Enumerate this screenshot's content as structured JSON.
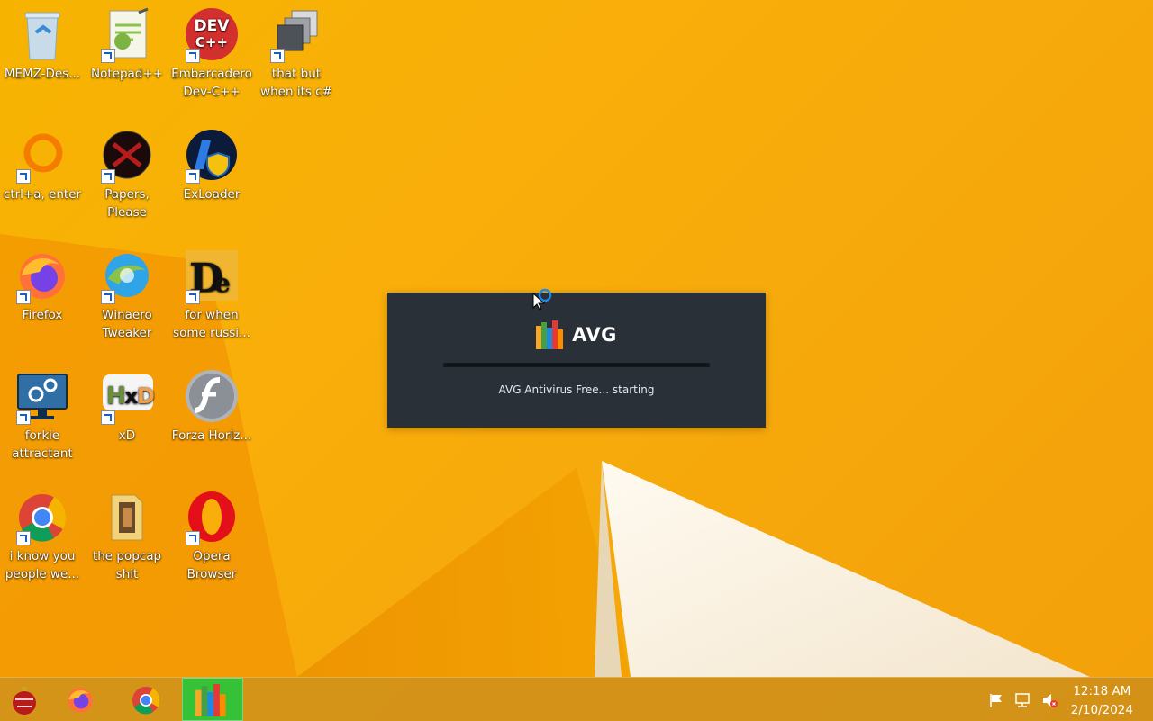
{
  "desktop": {
    "icons": [
      {
        "label": "MEMZ-Des...",
        "icon": "recycle-bin-icon"
      },
      {
        "label": "Notepad++",
        "icon": "notepadpp-icon"
      },
      {
        "label": "Embarcadero Dev-C++",
        "icon": "devcpp-icon"
      },
      {
        "label": "that but when its c#",
        "icon": "stack-icon"
      },
      {
        "label": "ctrl+a, enter",
        "icon": "orange-ring-icon"
      },
      {
        "label": "Papers, Please",
        "icon": "papers-please-icon"
      },
      {
        "label": "ExLoader",
        "icon": "exloader-icon"
      },
      {
        "label": "Firefox",
        "icon": "firefox-icon"
      },
      {
        "label": "Winaero Tweaker",
        "icon": "winaero-icon"
      },
      {
        "label": "for when some russi...",
        "icon": "de-icon"
      },
      {
        "label": "forkie attractant",
        "icon": "monitor-gear-icon"
      },
      {
        "label": "xD",
        "icon": "hxd-icon"
      },
      {
        "label": "Forza Horiz...",
        "icon": "flash-icon"
      },
      {
        "label": "i know you people we...",
        "icon": "chrome-icon"
      },
      {
        "label": "the popcap shit",
        "icon": "folder-icon"
      },
      {
        "label": "Opera Browser",
        "icon": "opera-icon"
      }
    ]
  },
  "splash": {
    "logo_text": "AVG",
    "status": "AVG Antivirus Free... starting",
    "progress": 0
  },
  "taskbar": {
    "buttons": [
      {
        "icon": "ornament-icon"
      },
      {
        "icon": "firefox-icon"
      },
      {
        "icon": "chrome-icon"
      },
      {
        "icon": "avg-icon",
        "active": true
      }
    ],
    "tray": {
      "icons": [
        "action-center-flag-icon",
        "network-icon",
        "volume-muted-icon"
      ],
      "time": "12:18 AM",
      "date": "2/10/2024"
    }
  },
  "colors": {
    "wallpaper": "#f6b400",
    "splash_bg": "#293037",
    "taskbar": "#c88c1e"
  }
}
